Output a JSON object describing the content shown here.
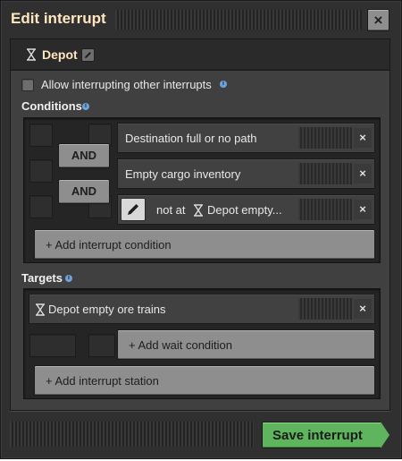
{
  "window": {
    "title": "Edit interrupt",
    "close_label": "×"
  },
  "interrupt": {
    "name": "Depot"
  },
  "allow_interrupting": {
    "label": "Allow interrupting other interrupts",
    "checked": false
  },
  "conditions": {
    "label": "Conditions",
    "connectors": [
      "AND",
      "AND"
    ],
    "rows": [
      {
        "text": "Destination full or no path"
      },
      {
        "text": "Empty cargo inventory"
      },
      {
        "prefix": "not at",
        "station": "Depot empty..."
      }
    ],
    "remove_label": "×",
    "add_label": "+ Add interrupt condition"
  },
  "targets": {
    "label": "Targets",
    "station": "Depot empty ore trains",
    "remove_label": "×",
    "add_wait_label": "+ Add wait condition",
    "add_station_label": "+ Add interrupt station"
  },
  "footer": {
    "save_label": "Save interrupt"
  },
  "colors": {
    "title": "#ffe6c0",
    "accent_green": "#5eb55d",
    "panel": "#414041"
  },
  "icons": [
    "hourglass-icon",
    "edit-icon",
    "info-icon",
    "close-icon",
    "pencil-icon",
    "remove-icon"
  ]
}
